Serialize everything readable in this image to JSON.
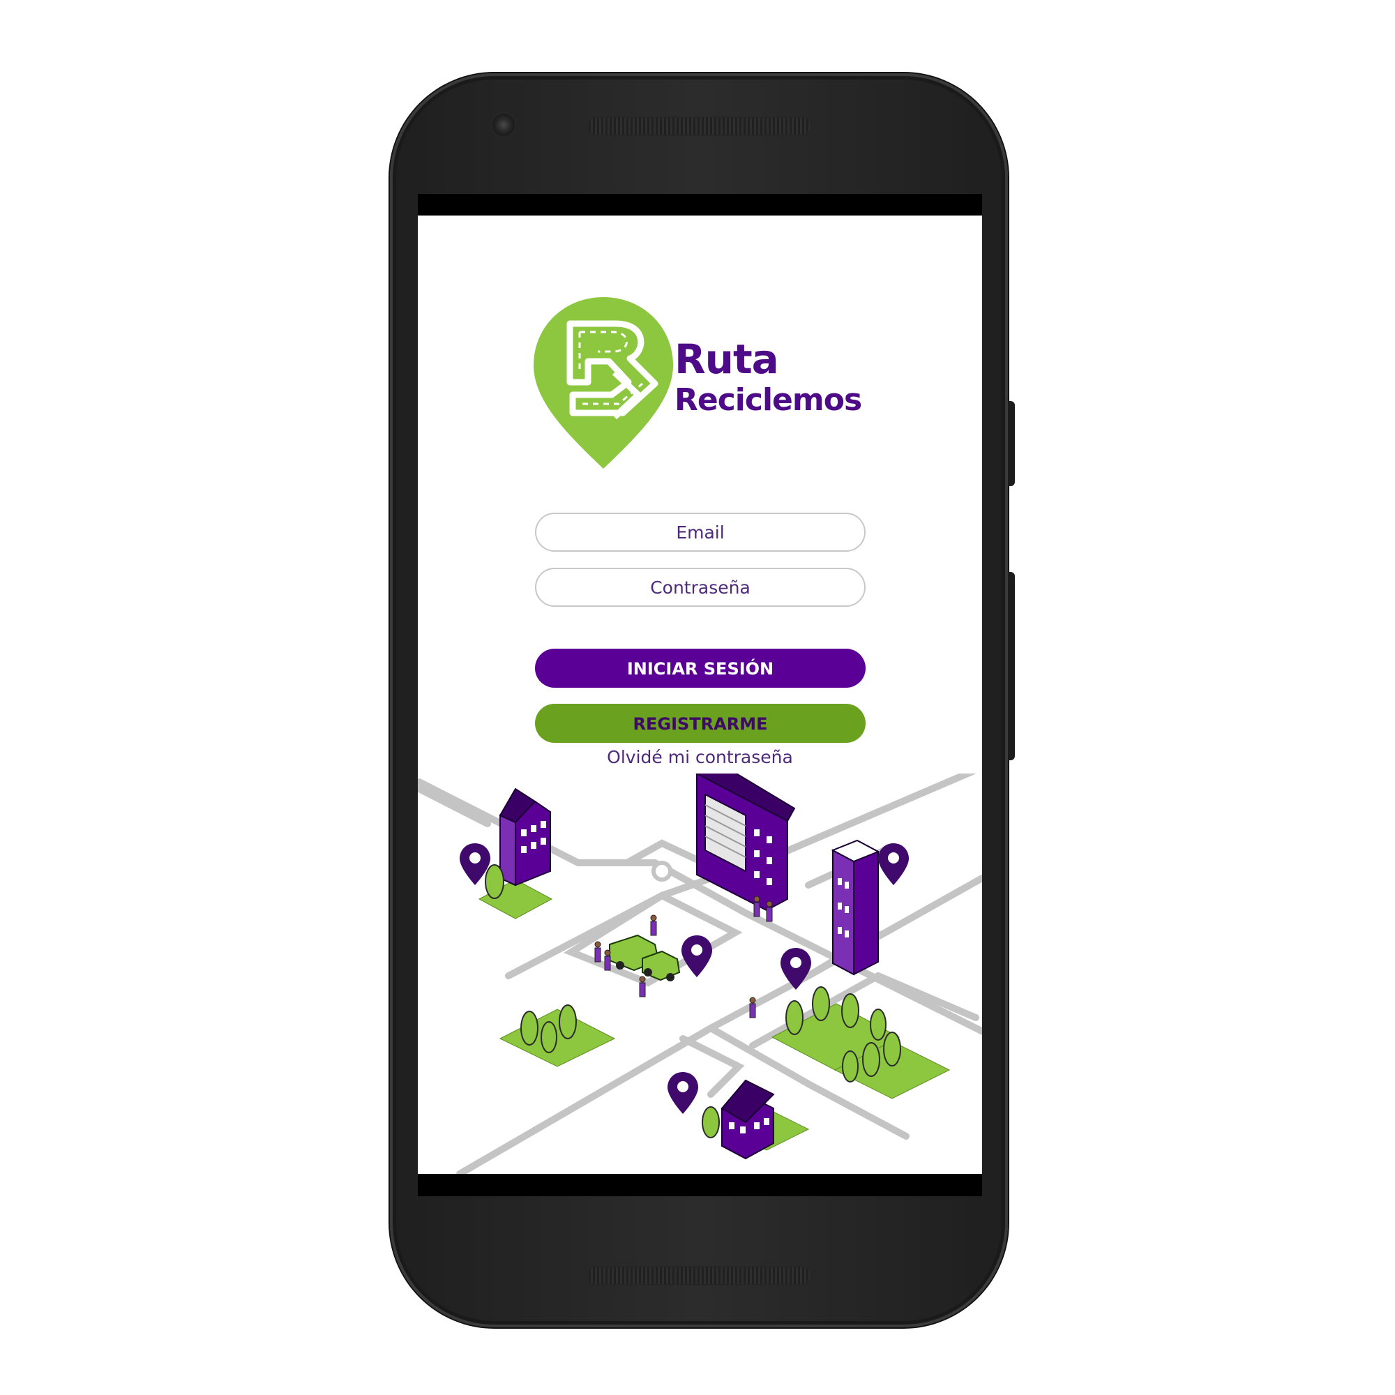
{
  "app": {
    "brand_line1": "Ruta",
    "brand_line2": "Reciclemos"
  },
  "login_form": {
    "email_placeholder": "Email",
    "password_placeholder": "Contraseña",
    "login_label": "INICIAR SESIÓN",
    "register_label": "REGISTRARME",
    "forgot_label": "Olvidé mi contraseña"
  },
  "colors": {
    "brand_purple": "#5a0097",
    "brand_green": "#8dc63f",
    "button_green": "#6aa11f",
    "text_purple": "#4e2a7a"
  },
  "icons": [
    "route-logo-icon",
    "location-pin-icon",
    "building-icon",
    "tree-icon",
    "car-icon",
    "person-icon"
  ]
}
